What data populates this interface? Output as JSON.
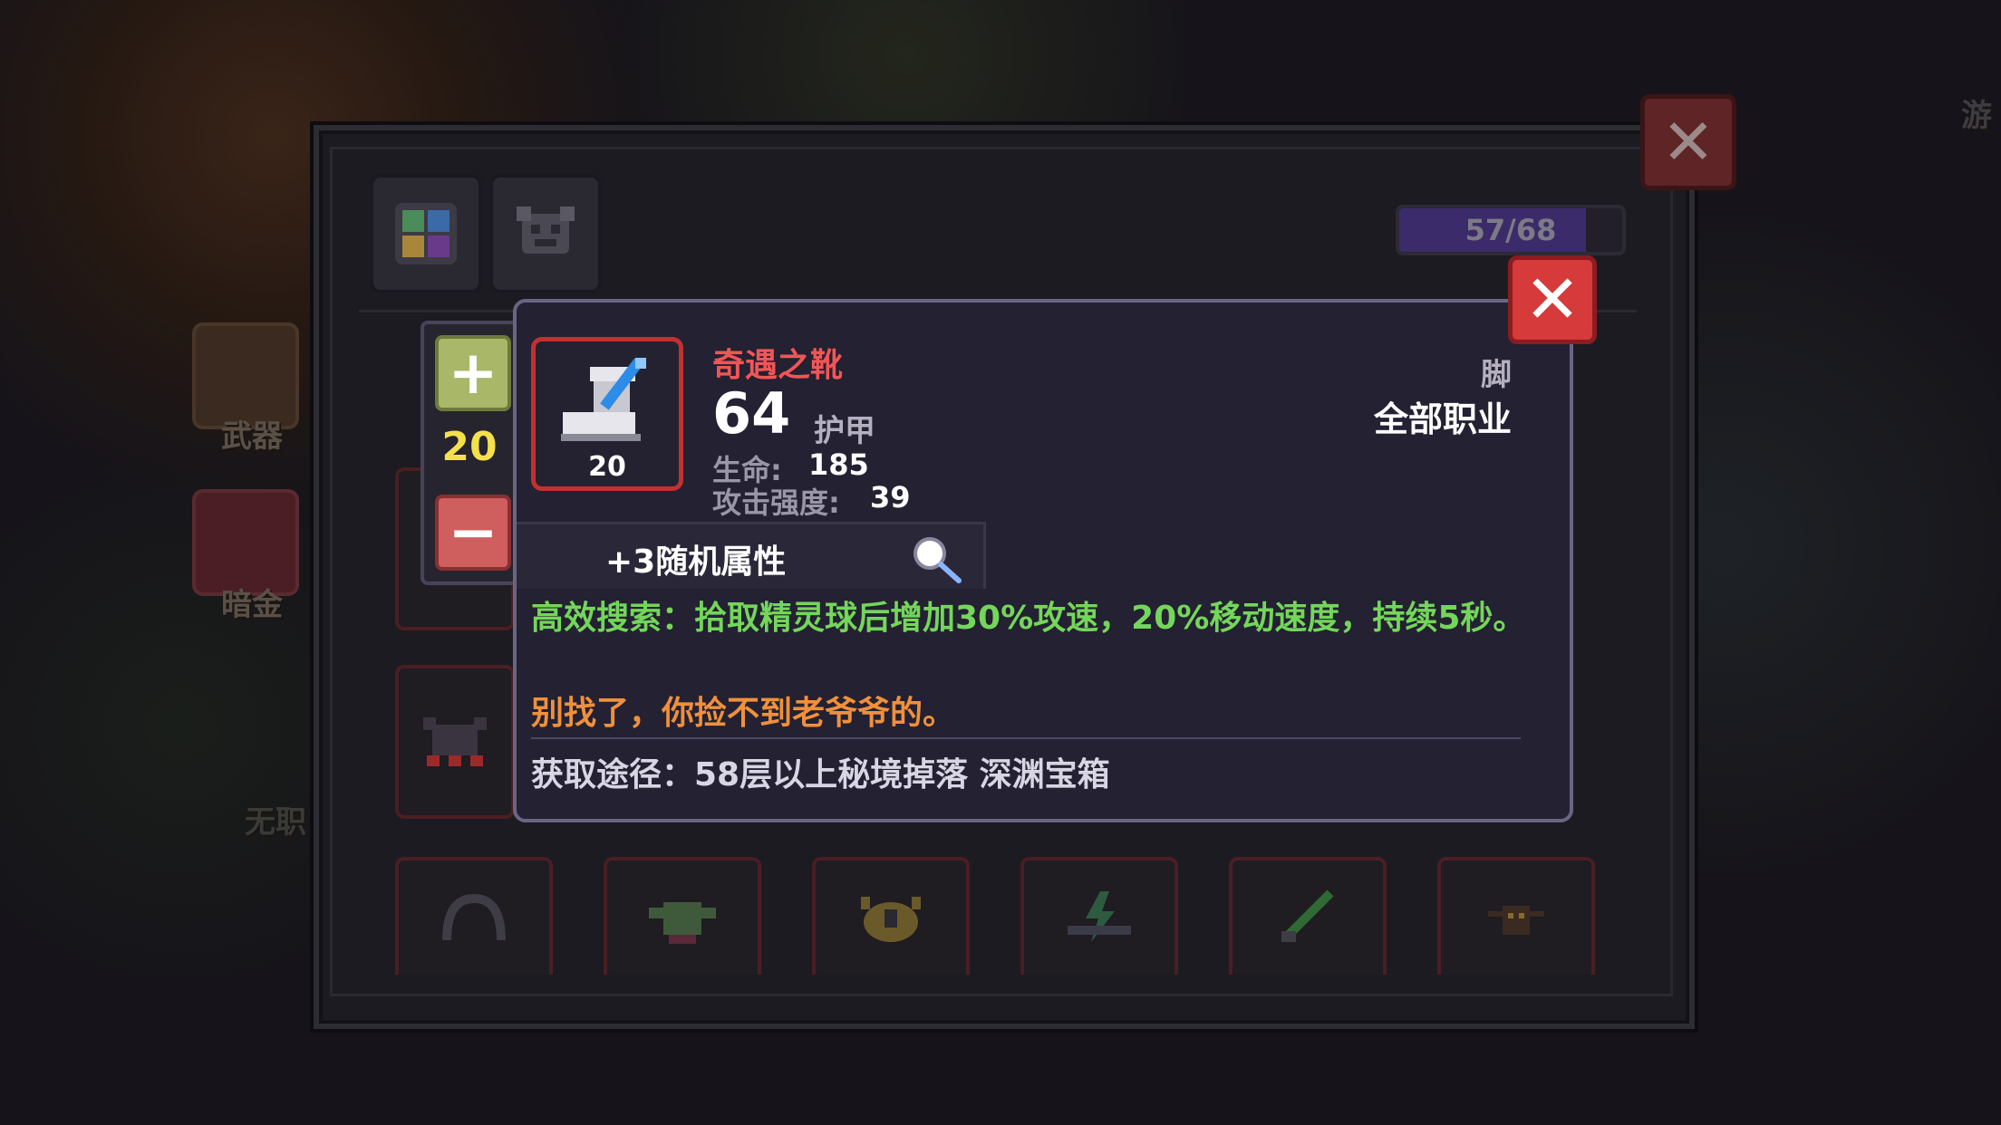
{
  "background": {
    "side_labels": [
      "武器",
      "暗金",
      "无职"
    ],
    "corner_label": "游"
  },
  "panel": {
    "capacity": {
      "text": "57/68",
      "fraction": 0.838
    },
    "tabs": [
      "grid-icon",
      "pet-icon"
    ]
  },
  "stepper": {
    "plus": "+",
    "minus": "−",
    "count": "20"
  },
  "tooltip": {
    "item_name": "奇遇之靴",
    "level": "20",
    "armor_value": "64",
    "armor_label": "护甲",
    "stats": [
      {
        "label": "生命:",
        "value": "185"
      },
      {
        "label": "攻击强度:",
        "value": "39"
      }
    ],
    "slot": "脚",
    "class": "全部职业",
    "random_attr": "+3随机属性",
    "effect": "高效搜索：拾取精灵球后增加30%攻速，20%移动速度，持续5秒。",
    "flavor": "别找了，你捡不到老爷爷的。",
    "source": "获取途径：58层以上秘境掉落 深渊宝箱"
  },
  "colors": {
    "item_name": "#f05656",
    "effect": "#74d65a",
    "flavor": "#f0903c",
    "rarity_border": "#c33030"
  }
}
